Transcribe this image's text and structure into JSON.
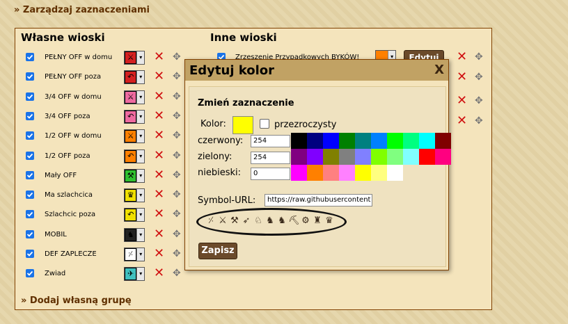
{
  "top_link": "» Zarządzaj zaznaczeniami",
  "own": {
    "title": "Własne wioski",
    "rows": [
      {
        "label": "PEŁNY OFF w domu",
        "color": "#d42020",
        "icon": "axe-icon"
      },
      {
        "label": "PEŁNY OFF poza",
        "color": "#d42020",
        "icon": "return-icon"
      },
      {
        "label": "3/4 OFF w domu",
        "color": "#ee6aa0",
        "icon": "axe-icon"
      },
      {
        "label": "3/4 OFF poza",
        "color": "#ee6aa0",
        "icon": "return-icon"
      },
      {
        "label": "1/2 OFF w domu",
        "color": "#ff8000",
        "icon": "axe-icon"
      },
      {
        "label": "1/2 OFF poza",
        "color": "#ff8000",
        "icon": "return-icon"
      },
      {
        "label": "Mały OFF",
        "color": "#30c030",
        "icon": "small-axe-icon"
      },
      {
        "label": "Ma szlachcica",
        "color": "#f0e000",
        "icon": "noble-icon"
      },
      {
        "label": "Szlachcic poza",
        "color": "#f0e000",
        "icon": "return-icon"
      },
      {
        "label": "MOBIL",
        "color": "#222222",
        "icon": "cavalry-icon"
      },
      {
        "label": "DEF ZAPLECZE",
        "color": "#ffffff",
        "icon": "spear-icon"
      },
      {
        "label": "Zwiad",
        "color": "#40c0c0",
        "icon": "scout-icon"
      }
    ]
  },
  "other": {
    "title": "Inne wioski",
    "rows": [
      {
        "label": "Zrzeszenie Przypadkowych BYKÓW!",
        "color": "#ff8000"
      }
    ],
    "edit_button": "Edytuj"
  },
  "add_link": "» Dodaj własną grupę",
  "dialog": {
    "title": "Edytuj kolor",
    "close": "X",
    "section_title": "Zmień zaznaczenie",
    "color_label": "Kolor:",
    "current_color": "#ffff00",
    "transparent_label": "przezroczysty",
    "red_label": "czerwony:",
    "red_value": "254",
    "green_label": "zielony:",
    "green_value": "254",
    "blue_label": "niebieski:",
    "blue_value": "0",
    "palette": [
      "#000000",
      "#000080",
      "#0000ff",
      "#008000",
      "#008080",
      "#0080ff",
      "#00ff00",
      "#00ff80",
      "#00ffff",
      "#800000",
      "#800080",
      "#8000ff",
      "#808000",
      "#808080",
      "#8080ff",
      "#80ff00",
      "#80ff80",
      "#80ffff",
      "#ff0000",
      "#ff0080",
      "#ff00ff",
      "#ff8000",
      "#ff8080",
      "#ff80ff",
      "#ffff00",
      "#ffff80",
      "#ffffff"
    ],
    "symbol_label": "Symbol-URL:",
    "symbol_url": "https://raw.githubusercontent",
    "symbols": [
      "spear-icon",
      "sword-icon",
      "axe-icon",
      "archer-icon",
      "light-cav-icon",
      "heavy-cav-icon",
      "horse-icon",
      "ram-icon",
      "catapult-icon",
      "knight-icon",
      "noble-icon"
    ],
    "save_label": "Zapisz"
  }
}
